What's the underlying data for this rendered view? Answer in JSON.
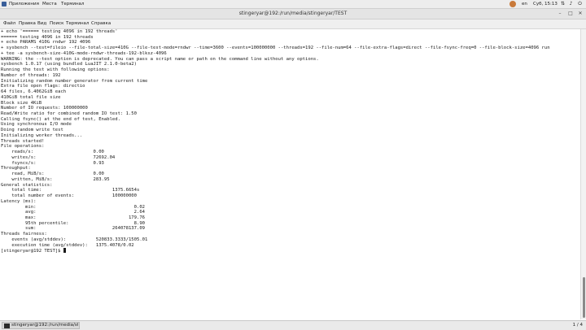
{
  "top_panel": {
    "menu": [
      "Приложения",
      "Места",
      "Терминал"
    ],
    "language": "en",
    "clock": "Суб, 15:13",
    "icons": [
      "network-icon",
      "volume-icon",
      "power-icon"
    ]
  },
  "window": {
    "title": "stingeryar@192:/run/media/stingeryar/TEST",
    "buttons": [
      "minimize-icon",
      "maximize-icon",
      "close-icon"
    ]
  },
  "menubar": [
    "Файл",
    "Правка",
    "Вид",
    "Поиск",
    "Терминал",
    "Справка"
  ],
  "terminal": {
    "lines": [
      "+ echo '====== testing 4096 in 192 threads'",
      "====== testing 4096 in 192 threads",
      "+ echo PARAMS 410G rndwr 192 4096",
      "+ sysbench --test=fileio --file-total-size=410G --file-test-mode=rndwr --time=3600 --events=100000000 --threads=192 --file-num=64 --file-extra-flags=direct --file-fsync-freq=0 --file-block-size=4096 run",
      "+ tee -a sysbench-size-410G-mode-rndwr-threads-192-blksz-4096",
      "WARNING: the --test option is deprecated. You can pass a script name or path on the command line without any options.",
      "sysbench 1.0.17 (using bundled LuaJIT 2.1.0-beta2)",
      "",
      "Running the test with following options:",
      "Number of threads: 192",
      "Initializing random number generator from current time",
      "",
      "",
      "Extra file open flags: directio",
      "64 files, 6.4062GiB each",
      "410GiB total file size",
      "Block size 4KiB",
      "Number of IO requests: 100000000",
      "Read/Write ratio for combined random IO test: 1.50",
      "Calling fsync() at the end of test, Enabled.",
      "Using synchronous I/O mode",
      "Doing random write test",
      "Initializing worker threads...",
      "",
      "Threads started!",
      "",
      "",
      "File operations:",
      "    reads/s:                      0.00",
      "    writes/s:                     72692.04",
      "    fsyncs/s:                     0.93",
      "",
      "Throughput:",
      "    read, MiB/s:                  0.00",
      "    written, MiB/s:               283.95",
      "",
      "General statistics:",
      "    total time:                          1375.6654s",
      "    total number of events:              100000000",
      "",
      "Latency (ms):",
      "         min:                                    0.02",
      "         avg:                                    2.64",
      "         max:                                  179.76",
      "         95th percentile:                        8.90",
      "         sum:                            264078137.09",
      "",
      "Threads fairness:",
      "    events (avg/stddev):           520833.3333/1505.01",
      "    execution time (avg/stddev):   1375.4078/0.02",
      "",
      "[stingeryar@192 TEST]$ "
    ]
  },
  "taskbar": {
    "task_label": "stingeryar@192:/run/media/stingery...",
    "workspace": "1 / 4"
  }
}
